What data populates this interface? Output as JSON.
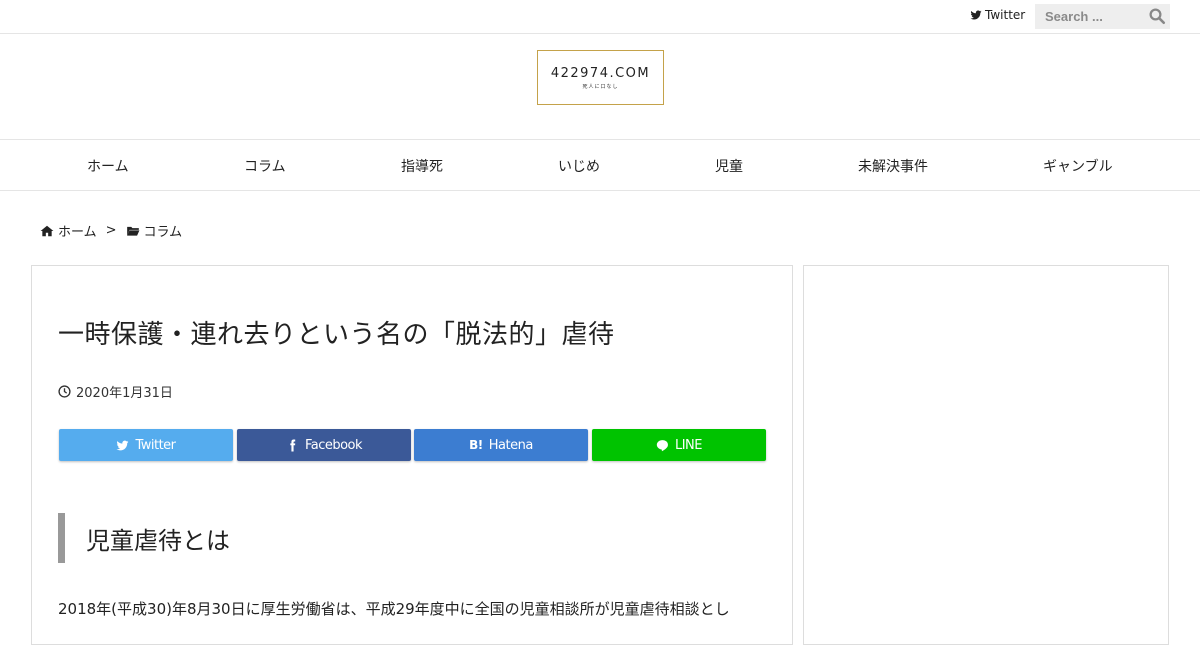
{
  "topbar": {
    "twitter_label": "Twitter",
    "search_placeholder": "Search ..."
  },
  "logo": {
    "main": "422974.COM",
    "sub": "死人に口なし"
  },
  "nav": [
    {
      "label": "ホーム"
    },
    {
      "label": "コラム"
    },
    {
      "label": "指導死"
    },
    {
      "label": "いじめ"
    },
    {
      "label": "児童"
    },
    {
      "label": "未解決事件"
    },
    {
      "label": "ギャンブル"
    }
  ],
  "breadcrumb": {
    "home": "ホーム",
    "separator": ">",
    "category": "コラム"
  },
  "article": {
    "title": "一時保護・連れ去りという名の「脱法的」虐待",
    "date": "2020年1月31日",
    "heading": "児童虐待とは",
    "body": "2018年(平成30)年8月30日に厚生労働省は、平成29年度中に全国の児童相談所が児童虐待相談とし"
  },
  "share": {
    "twitter": "Twitter",
    "facebook": "Facebook",
    "hatena_mark": "B!",
    "hatena": "Hatena",
    "line": "LINE"
  },
  "colors": {
    "twitter": "#55acee",
    "facebook": "#3b5998",
    "hatena": "#3c7dd1",
    "line": "#00c300",
    "logo_border": "#c4a24a"
  }
}
